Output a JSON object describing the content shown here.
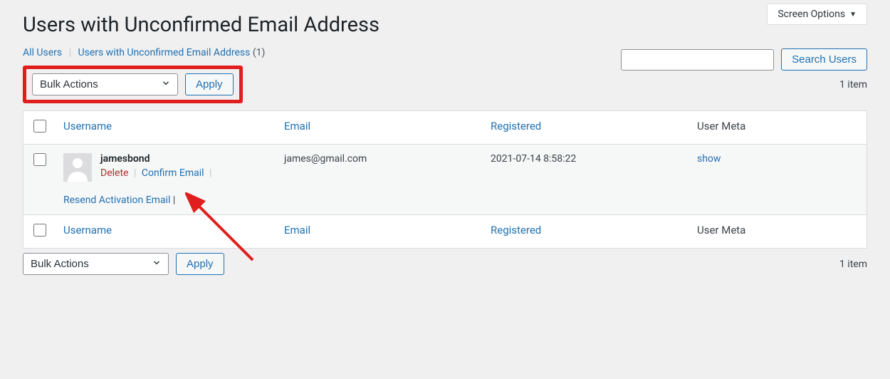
{
  "screenOptions": {
    "label": "Screen Options"
  },
  "page": {
    "title": "Users with Unconfirmed Email Address"
  },
  "subsubsub": {
    "allUsers": "All Users",
    "current": "Users with Unconfirmed Email Address",
    "count": "(1)"
  },
  "bulk": {
    "placeholder": "Bulk Actions",
    "apply": "Apply"
  },
  "search": {
    "button": "Search Users",
    "value": ""
  },
  "tablenav": {
    "items": "1 item"
  },
  "columns": {
    "username": "Username",
    "email": "Email",
    "registered": "Registered",
    "usermeta": "User Meta"
  },
  "rows": [
    {
      "username": "jamesbond",
      "email": "james@gmail.com",
      "registered": "2021-07-14 8:58:22",
      "usermeta": "show",
      "actions": {
        "delete": "Delete",
        "confirm": "Confirm Email",
        "resend": "Resend Activation Email"
      }
    }
  ],
  "colors": {
    "link": "#2271b1",
    "danger": "#b32d2e",
    "highlight": "#e11e1e",
    "background": "#f0f0f1"
  }
}
